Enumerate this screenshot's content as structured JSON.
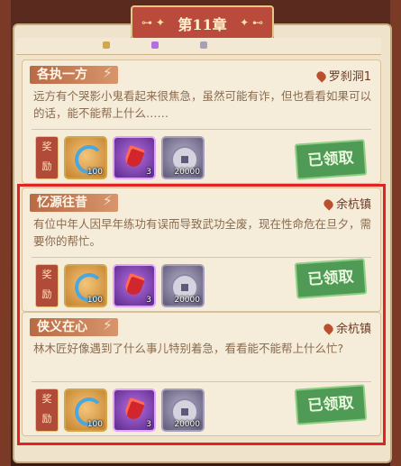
{
  "chapter": {
    "title": "第11章"
  },
  "quests": [
    {
      "title": "各执一方",
      "location": "罗刹洞1",
      "description": "远方有个哭影小鬼看起来很焦急，虽然可能有诈，但也看看如果可以的话，能不能帮上什么……",
      "reward_label": "奖励",
      "rewards": [
        {
          "icon": "swirl-icon",
          "count": "100"
        },
        {
          "icon": "red-gem-icon",
          "count": "3"
        },
        {
          "icon": "coin-icon",
          "count": "20000"
        }
      ],
      "status": "已领取"
    },
    {
      "title": "忆源往昔",
      "location": "余杭镇",
      "description": "有位中年人因早年练功有误而导致武功全废，现在性命危在旦夕，需要你的帮忙。",
      "reward_label": "奖励",
      "rewards": [
        {
          "icon": "swirl-icon",
          "count": "100"
        },
        {
          "icon": "red-gem-icon",
          "count": "3"
        },
        {
          "icon": "coin-icon",
          "count": "20000"
        }
      ],
      "status": "已领取"
    },
    {
      "title": "侠义在心",
      "location": "余杭镇",
      "description": "林木匠好像遇到了什么事儿特别着急，看看能不能帮上什么忙?",
      "reward_label": "奖励",
      "rewards": [
        {
          "icon": "swirl-icon",
          "count": "100"
        },
        {
          "icon": "red-gem-icon",
          "count": "3"
        },
        {
          "icon": "coin-icon",
          "count": "20000"
        }
      ],
      "status": "已领取"
    }
  ],
  "colors": {
    "highlight": "#e42222",
    "claimed_stamp": "#4f9b55",
    "tag": "#b86a44"
  }
}
